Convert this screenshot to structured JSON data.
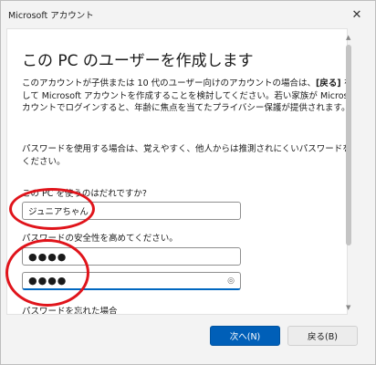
{
  "window": {
    "title": "Microsoft アカウント"
  },
  "page": {
    "heading": "この PC のユーザーを作成します",
    "intro_before_bold": "このアカウントが子供または 10 代のユーザー向けのアカウントの場合は、",
    "intro_bold": "[戻る]",
    "intro_after_bold": " を選択して Microsoft アカウントを作成することを検討してください。若い家族が Microsoft アカウントでログインすると、年齢に焦点を当てたプライバシー保護が提供されます。",
    "password_note": "パスワードを使用する場合は、覚えやすく、他人からは推測されにくいパスワードを選んでください。",
    "user_label": "この PC を使うのはだれですか?",
    "user_value": "ジュニアちゃん",
    "password_label": "パスワードの安全性を高めてください。",
    "password_value": "●●●●",
    "confirm_value": "●●●●",
    "forgot_link": "パスワードを忘れた場合"
  },
  "buttons": {
    "next": "次へ(N)",
    "back": "戻る(B)"
  },
  "colors": {
    "primary": "#005fb8",
    "annotation": "#e0141b"
  }
}
